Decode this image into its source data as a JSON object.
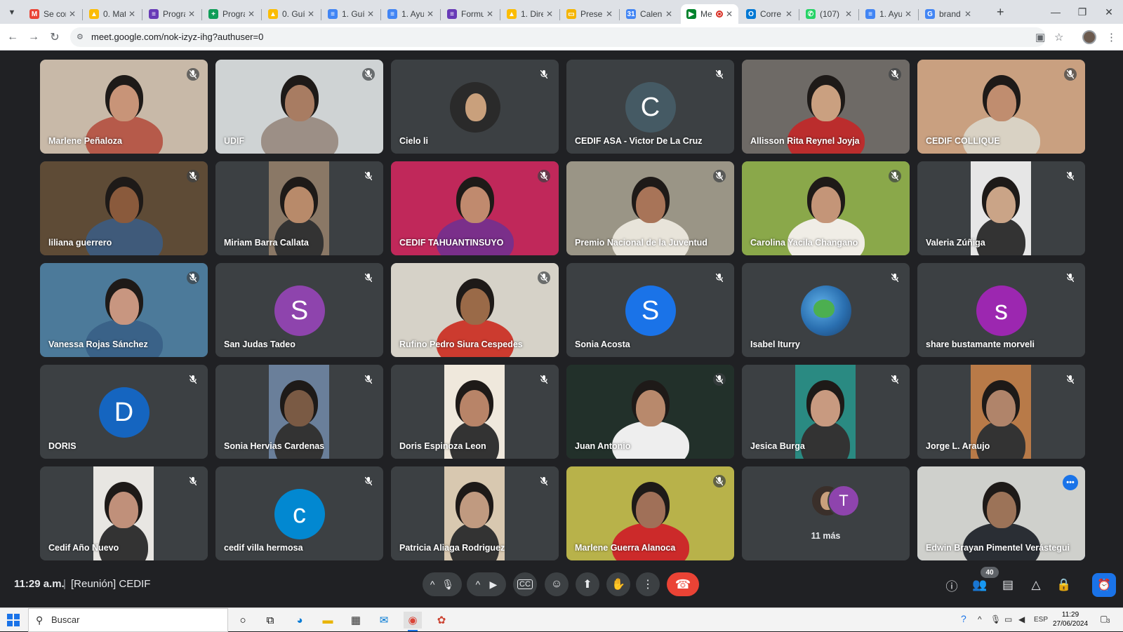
{
  "browser": {
    "tabs": [
      {
        "label": "Se cor",
        "icon": "gmail-icon",
        "color": "#ea4335",
        "letter": "M"
      },
      {
        "label": "0. Mat",
        "icon": "drive-icon",
        "color": "#fbbc04",
        "letter": "▲"
      },
      {
        "label": "Progra",
        "icon": "forms-icon",
        "color": "#673ab7",
        "letter": "≡"
      },
      {
        "label": "Progra",
        "icon": "sheets-icon",
        "color": "#0f9d58",
        "letter": "+"
      },
      {
        "label": "0. Guí",
        "icon": "drive-icon",
        "color": "#fbbc04",
        "letter": "▲"
      },
      {
        "label": "1. Guí",
        "icon": "docs-icon",
        "color": "#4285f4",
        "letter": "≡"
      },
      {
        "label": "1. Ayu",
        "icon": "docs-icon",
        "color": "#4285f4",
        "letter": "≡"
      },
      {
        "label": "Formu",
        "icon": "forms-icon",
        "color": "#673ab7",
        "letter": "≡"
      },
      {
        "label": "1. Dire",
        "icon": "drive-icon",
        "color": "#fbbc04",
        "letter": "▲"
      },
      {
        "label": "Preser",
        "icon": "slides-icon",
        "color": "#f4b400",
        "letter": "▭"
      },
      {
        "label": "Calen",
        "icon": "calendar-icon",
        "color": "#4285f4",
        "letter": "31"
      },
      {
        "label": "Me",
        "icon": "meet-icon",
        "color": "#00832d",
        "letter": "▶",
        "active": true
      },
      {
        "label": "Corre",
        "icon": "outlook-icon",
        "color": "#0078d4",
        "letter": "O"
      },
      {
        "label": "(107)",
        "icon": "whatsapp-icon",
        "color": "#25d366",
        "letter": "✆"
      },
      {
        "label": "1. Ayu",
        "icon": "docs-icon",
        "color": "#4285f4",
        "letter": "≡"
      },
      {
        "label": "brand",
        "icon": "google-icon",
        "color": "#4285f4",
        "letter": "G"
      }
    ],
    "url": "meet.google.com/nok-izyz-ihg?authuser=0"
  },
  "meeting": {
    "time": "11:29 a.m.",
    "separator": "|",
    "title": "[Reunión] CEDIF",
    "participant_count": "40",
    "participants": [
      {
        "name": "Marlene Peñaloza",
        "kind": "video",
        "bg": "#c8b9a8",
        "video": "#b65a4a",
        "skin": "#c89478"
      },
      {
        "name": "UDIF",
        "kind": "video",
        "bg": "#cfd3d4",
        "video": "#9c8f86",
        "skin": "#a87c62"
      },
      {
        "name": "Cielo li",
        "kind": "photo",
        "bg": "#3c4043",
        "video": "#2a2a2a",
        "skin": "#c9a07c"
      },
      {
        "name": "CEDIF ASA - Victor De La Cruz",
        "kind": "avatar",
        "letter": "C",
        "avatar": "#455a64"
      },
      {
        "name": "Allisson Rita Reynel Joyja",
        "kind": "video",
        "bg": "#6e6a66",
        "video": "#bb2d2d",
        "skin": "#caa080"
      },
      {
        "name": "CEDIF COLLIQUE",
        "kind": "video",
        "bg": "#c9a080",
        "video": "#d9d2c4",
        "skin": "#c08d6f"
      },
      {
        "name": "liliana guerrero",
        "kind": "video",
        "bg": "#5e4b36",
        "video": "#3f5a7a",
        "skin": "#8a5a3c"
      },
      {
        "name": "Miriam Barra Callata",
        "kind": "video",
        "bg": "#3c4043",
        "video": "#8a7866",
        "skin": "#b88a6a"
      },
      {
        "name": "CEDIF TAHUANTINSUYO",
        "kind": "video",
        "bg": "#c0285a",
        "video": "#7a2f8a",
        "skin": "#c08a6e"
      },
      {
        "name": "Premio Nacional de la Juventud",
        "kind": "video",
        "bg": "#9a9586",
        "video": "#e8e4da",
        "skin": "#a87458"
      },
      {
        "name": "Carolina Yacila Changano",
        "kind": "video",
        "bg": "#8aa84a",
        "video": "#f0ede6",
        "skin": "#c49578"
      },
      {
        "name": "Valeria Zúñiga",
        "kind": "video",
        "bg": "#3c4043",
        "video": "#e6e6e6",
        "skin": "#caa487"
      },
      {
        "name": "Vanessa Rojas Sánchez",
        "kind": "video",
        "bg": "#4c7a9a",
        "video": "#3a6288",
        "skin": "#c89680"
      },
      {
        "name": "San Judas Tadeo",
        "kind": "avatar",
        "letter": "S",
        "avatar": "#8e44ad"
      },
      {
        "name": "Rufino Pedro Siura Cespedes",
        "kind": "video",
        "bg": "#d6d2c8",
        "video": "#cc3b2f",
        "skin": "#9a6a48"
      },
      {
        "name": "Sonia Acosta",
        "kind": "avatar",
        "letter": "S",
        "avatar": "#1a73e8"
      },
      {
        "name": "Isabel Iturry",
        "kind": "globe",
        "bg": "#3c4043"
      },
      {
        "name": "share bustamante morveli",
        "kind": "avatar",
        "letter": "s",
        "avatar": "#9c27b0"
      },
      {
        "name": "DORIS",
        "kind": "avatar",
        "letter": "D",
        "avatar": "#1565c0"
      },
      {
        "name": "Sonia Hervias Cardenas",
        "kind": "video",
        "bg": "#3c4043",
        "video": "#6a7f9a",
        "skin": "#7a5a44"
      },
      {
        "name": "Doris Espinoza Leon",
        "kind": "video",
        "bg": "#3c4043",
        "video": "#efe8dc",
        "skin": "#b88468"
      },
      {
        "name": "Juan Antonio",
        "kind": "video",
        "bg": "#22302a",
        "video": "#eeeeee",
        "skin": "#b8896c"
      },
      {
        "name": "Jesica Burga",
        "kind": "video",
        "bg": "#3c4043",
        "video": "#2a8a82",
        "skin": "#c89a80"
      },
      {
        "name": "Jorge L. Araujo",
        "kind": "video",
        "bg": "#3c4043",
        "video": "#b87a48",
        "skin": "#b0846a"
      },
      {
        "name": "Cedif Año Nuevo",
        "kind": "video",
        "bg": "#3c4043",
        "video": "#e8e6e2",
        "skin": "#c0907a"
      },
      {
        "name": "cedif villa hermosa",
        "kind": "avatar",
        "letter": "c",
        "avatar": "#0288d1"
      },
      {
        "name": "Patricia Aliaga Rodriguez",
        "kind": "video",
        "bg": "#3c4043",
        "video": "#d8c8b0",
        "skin": "#c09a80"
      },
      {
        "name": "Marlene Guerra Alanoca",
        "kind": "video",
        "bg": "#b8b24a",
        "video": "#cc2a2a",
        "skin": "#a07058"
      },
      {
        "name": "11 más",
        "kind": "more",
        "letter": "T",
        "avatar": "#8e44ad"
      },
      {
        "name": "Edwin Brayan Pimentel Verástegui",
        "kind": "video",
        "bg": "#cfd0cc",
        "video": "#2a2e34",
        "skin": "#9c7358",
        "active": true
      }
    ]
  },
  "taskbar": {
    "search_placeholder": "Buscar",
    "lang": "ESP",
    "time": "11:29",
    "date": "27/06/2024",
    "notifications": "3"
  }
}
